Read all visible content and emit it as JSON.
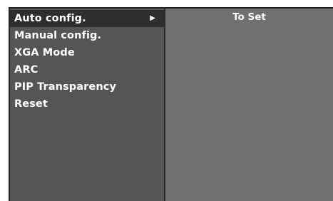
{
  "menu": {
    "items": [
      {
        "label": "Auto config.",
        "selected": true
      },
      {
        "label": "Manual config.",
        "selected": false
      },
      {
        "label": "XGA Mode",
        "selected": false
      },
      {
        "label": "ARC",
        "selected": false
      },
      {
        "label": "PIP Transparency",
        "selected": false
      },
      {
        "label": "Reset",
        "selected": false
      }
    ],
    "submenu_arrow_icon": "right-triangle-icon"
  },
  "panel": {
    "value": "To Set"
  },
  "colors": {
    "menu_bg": "#555555",
    "selected_bg": "#2e2e2e",
    "panel_bg": "#707070",
    "text": "#ffffff"
  }
}
